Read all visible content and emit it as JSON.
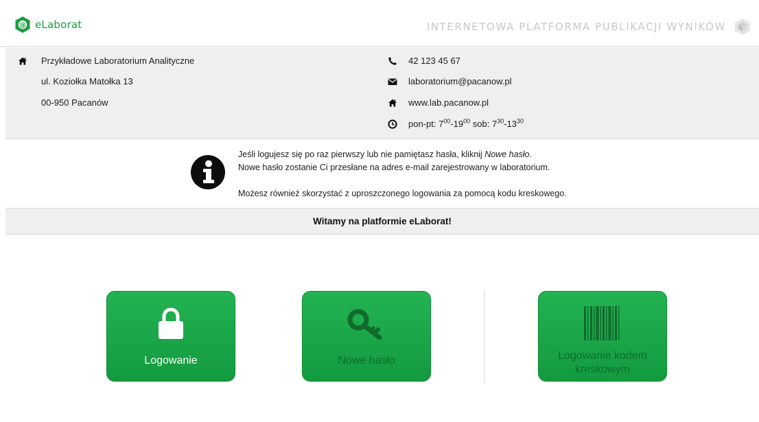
{
  "header": {
    "brand_name": "eLaborat",
    "platform_title": "INTERNETOWA PLATFORMA PUBLIKACJI WYNIKÓW",
    "logo_icon": "at-sign-hexagon-icon",
    "corner_icon": "cube-icon"
  },
  "contact": {
    "lab_name": "Przykładowe Laboratorium Analityczne",
    "street": "ul. Koziołka Matołka 13",
    "city": "00-950 Pacanów",
    "phone": "42 123 45 67",
    "email": "laboratorium@pacanow.pl",
    "website": "www.lab.pacanow.pl",
    "hours": {
      "weekday_prefix": "pon-pt: 7",
      "weekday_open_min": "00",
      "weekday_sep": "-19",
      "weekday_close_min": "00",
      "saturday_prefix": " sob: 7",
      "saturday_open_min": "30",
      "saturday_sep": "-13",
      "saturday_close_min": "30"
    }
  },
  "info": {
    "line1_text": "Jeśli logujesz się po raz pierwszy lub nie pamiętasz hasła, kliknij ",
    "line1_emphasis": "Nowe hasło",
    "line1_end": ".",
    "line2": "Nowe hasło zostanie Ci przesłane na adres e-mail zarejestrowany w laboratorium.",
    "line3": "Możesz również skorzystać z uproszczonego logowania za pomocą kodu kreskowego."
  },
  "welcome": "Witamy na platformie eLaborat!",
  "buttons": {
    "login": "Logowanie",
    "new_password": "Nowe hasło",
    "barcode_line1": "Logowanie kodem",
    "barcode_line2": "kreskowym"
  },
  "colors": {
    "brand_green": "#1a9b40",
    "tile_green": "#1aa648",
    "tile_dark_text": "#0c6d2b",
    "band_gray": "#efefef"
  }
}
